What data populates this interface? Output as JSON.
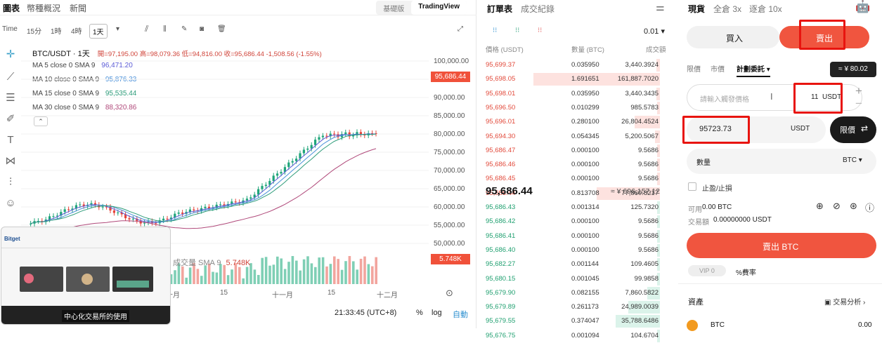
{
  "header": {
    "tabs": [
      "圖表",
      "幣種概況",
      "新聞"
    ],
    "chart_modes": [
      "基礎版",
      "TradingView"
    ],
    "active_mode": "TradingView"
  },
  "toolbar": {
    "time_label": "Time",
    "intervals": [
      "15分",
      "1時",
      "4時",
      "1天"
    ],
    "active_interval": "1天"
  },
  "chart": {
    "symbol": "BTC/USDT · 1天",
    "ohlc": "開=97,195.00 高=98,079.36 低=94,816.00 收=95,686.44 -1,508.56 (-1.55%)",
    "ma": [
      {
        "label": "MA 5 close 0 SMA 9",
        "value": "96,471.20",
        "color": "#5b5bd6"
      },
      {
        "label": "MA 10 close 0 SMA 9",
        "value": "95,876.33",
        "color": "#4a90d9"
      },
      {
        "label": "MA 15 close 0 SMA 9",
        "value": "95,535.44",
        "color": "#2e9c7a"
      },
      {
        "label": "MA 30 close 0 SMA 9",
        "value": "88,320.86",
        "color": "#b0497a"
      }
    ],
    "price_tag": "95,686.44",
    "volume_tag": "5.748K",
    "volume_label": "成交量 SMA 9",
    "volume_value": "5.748K",
    "y_axis": [
      "100,000.00",
      "95,000.00",
      "90,000.00",
      "85,000.00",
      "80,000.00",
      "75,000.00",
      "70,000.00",
      "65,000.00",
      "60,000.00",
      "55,000.00",
      "50,000.00"
    ],
    "x_axis": [
      "十月",
      "15",
      "十一月",
      "15",
      "十二月"
    ],
    "footer_time": "21:33:45 (UTC+8)",
    "footer_opts": [
      "%",
      "log",
      "自動"
    ],
    "watermark": "Bitget",
    "thumb_caption": "中心化交易所的使用"
  },
  "orderbook": {
    "tabs": [
      "訂單表",
      "成交紀錄"
    ],
    "precision": "0.01",
    "headers": [
      "價格 (USDT)",
      "數量 (BTC)",
      "成交額"
    ],
    "asks": [
      {
        "p": "95,699.37",
        "q": "0.035950",
        "t": "3,440.3924",
        "d": 0.03
      },
      {
        "p": "95,698.05",
        "q": "1.691651",
        "t": "161,887.7020",
        "d": 1.0
      },
      {
        "p": "95,698.01",
        "q": "0.035950",
        "t": "3,440.3435",
        "d": 0.03
      },
      {
        "p": "95,696.50",
        "q": "0.010299",
        "t": "985.5783",
        "d": 0.01
      },
      {
        "p": "95,696.01",
        "q": "0.280100",
        "t": "26,804.4524",
        "d": 0.2
      },
      {
        "p": "95,694.30",
        "q": "0.054345",
        "t": "5,200.5067",
        "d": 0.04
      },
      {
        "p": "95,686.47",
        "q": "0.000100",
        "t": "9.5686",
        "d": 0.0
      },
      {
        "p": "95,686.46",
        "q": "0.000100",
        "t": "9.5686",
        "d": 0.0
      },
      {
        "p": "95,686.45",
        "q": "0.000100",
        "t": "9.5686",
        "d": 0.0
      },
      {
        "p": "95,686.44",
        "q": "0.813708",
        "t": "77,860.8217",
        "d": 0.5
      }
    ],
    "last_price": "95,686.44",
    "last_cny": "≈ ¥ 696,157.12",
    "bids": [
      {
        "p": "95,686.43",
        "q": "0.001314",
        "t": "125.7320",
        "d": 0.01
      },
      {
        "p": "95,686.42",
        "q": "0.000100",
        "t": "9.5686",
        "d": 0.0
      },
      {
        "p": "95,686.41",
        "q": "0.000100",
        "t": "9.5686",
        "d": 0.0
      },
      {
        "p": "95,686.40",
        "q": "0.000100",
        "t": "9.5686",
        "d": 0.0
      },
      {
        "p": "95,682.27",
        "q": "0.001144",
        "t": "109.4605",
        "d": 0.01
      },
      {
        "p": "95,680.15",
        "q": "0.001045",
        "t": "99.9858",
        "d": 0.01
      },
      {
        "p": "95,679.90",
        "q": "0.082155",
        "t": "7,860.5822",
        "d": 0.1
      },
      {
        "p": "95,679.89",
        "q": "0.261173",
        "t": "24,989.0039",
        "d": 0.25
      },
      {
        "p": "95,679.55",
        "q": "0.374047",
        "t": "35,788.6486",
        "d": 0.35
      },
      {
        "p": "95,676.75",
        "q": "0.001094",
        "t": "104.6704",
        "d": 0.01
      }
    ]
  },
  "trade": {
    "tabs": [
      "現貨",
      "全倉 3x",
      "逐倉 10x"
    ],
    "buy": "買入",
    "sell": "賣出",
    "order_types": [
      "限價",
      "市價",
      "計劃委託"
    ],
    "tooltip": "≈ ¥ 80.02",
    "trigger_placeholder": "請輸入觸發價格",
    "trigger_value": "11",
    "trigger_unit": "USDT",
    "price_value": "95723.73",
    "price_unit": "USDT",
    "limit_btn": "限價",
    "qty_label": "數量",
    "qty_unit": "BTC",
    "tpsl": "止盈/止損",
    "available_label": "可用",
    "available_value": "0.00 BTC",
    "amount_label": "交易額",
    "amount_value": "0.00000000 USDT",
    "submit": "賣出 BTC",
    "vip": "VIP 0",
    "fee": "%費率",
    "assets": "資產",
    "analysis": "交易分析",
    "asset_coin": "BTC",
    "asset_value": "0.00"
  }
}
